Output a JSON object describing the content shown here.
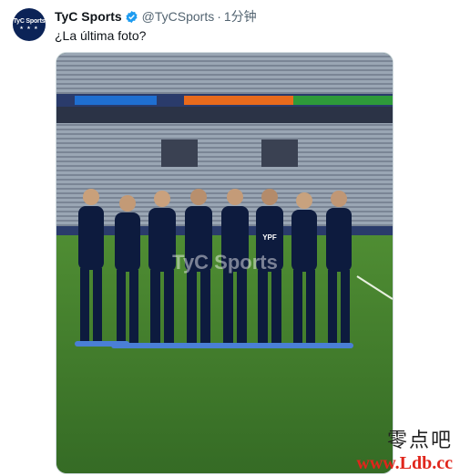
{
  "tweet": {
    "avatar_label": "TyC Sports",
    "avatar_stars": "★ ★ ★",
    "display_name": "TyC Sports",
    "handle": "@TyCSports",
    "separator": "·",
    "time": "1分钟",
    "text": "¿La última foto?"
  },
  "photo": {
    "watermark_on_image": "TyC Sports",
    "shirt_sponsor": "YPF"
  },
  "site_watermark": {
    "chinese": "零点吧",
    "url": "www.Ldb.cc"
  },
  "colors": {
    "verified": "#1d9bf0",
    "avatar_bg": "#0b2357",
    "kit": "#0d1b3e",
    "pitch": "#3f7c2b"
  }
}
